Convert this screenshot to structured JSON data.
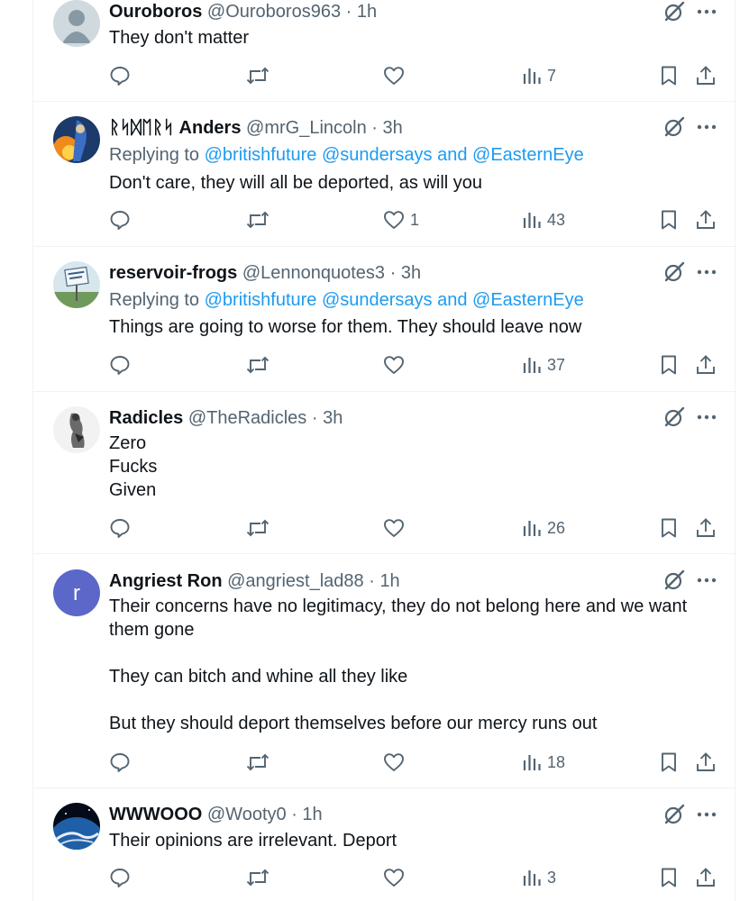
{
  "tweets": [
    {
      "name": "Ouroboros",
      "handle": "@Ouroboros963",
      "dot": "·",
      "time": "1h",
      "replying_prefix": "",
      "mentions": "",
      "text": [
        "They don't matter"
      ],
      "likes": "",
      "views": "7",
      "avatar": "default-profile"
    },
    {
      "name": "ᚱᛋᛞᛖᚱᛋ Anders",
      "handle": "@mrG_Lincoln",
      "dot": "·",
      "time": "3h",
      "replying_prefix": "Replying to",
      "mentions": "@britishfuture @sundersays and @EasternEye",
      "text": [
        "Don't care, they will all be deported, as will you"
      ],
      "likes": "1",
      "views": "43",
      "avatar": "fire-figure"
    },
    {
      "name": "reservoir-frogs",
      "handle": "@Lennonquotes3",
      "dot": "·",
      "time": "3h",
      "replying_prefix": "Replying to",
      "mentions": "@britishfuture @sundersays and @EasternEye",
      "text": [
        "Things are going to worse for them. They should leave now"
      ],
      "likes": "",
      "views": "37",
      "avatar": "dont-be-a-tosser-sign"
    },
    {
      "name": "Radicles",
      "handle": "@TheRadicles",
      "dot": "·",
      "time": "3h",
      "replying_prefix": "",
      "mentions": "",
      "text": [
        "Zero",
        "Fucks",
        "Given"
      ],
      "likes": "",
      "views": "26",
      "avatar": "sketch-figure"
    },
    {
      "name": "Angriest Ron",
      "handle": "@angriest_lad88",
      "dot": "·",
      "time": "1h",
      "replying_prefix": "",
      "mentions": "",
      "text": [
        "Their concerns have no legitimacy, they do not belong here and we want",
        "them gone",
        "",
        "They can bitch and whine all they like",
        "",
        "But they should deport themselves before our mercy runs out"
      ],
      "likes": "",
      "views": "18",
      "avatar": "letter-r",
      "avatar_letter": "r"
    },
    {
      "name": "WWWOOO",
      "handle": "@Wooty0",
      "dot": "·",
      "time": "1h",
      "replying_prefix": "",
      "mentions": "",
      "text": [
        "Their opinions are irrelevant. Deport"
      ],
      "likes": "",
      "views": "3",
      "avatar": "earth-from-space"
    }
  ],
  "colors": {
    "text": "#0f1419",
    "muted": "#536471",
    "link": "#1d9bf0",
    "border": "#eff3f4",
    "avatar_letter_bg": "#5b67c9"
  },
  "icons": [
    "reply-icon",
    "retweet-icon",
    "like-icon",
    "views-icon",
    "bookmark-icon",
    "share-icon",
    "grok-icon",
    "more-icon"
  ]
}
